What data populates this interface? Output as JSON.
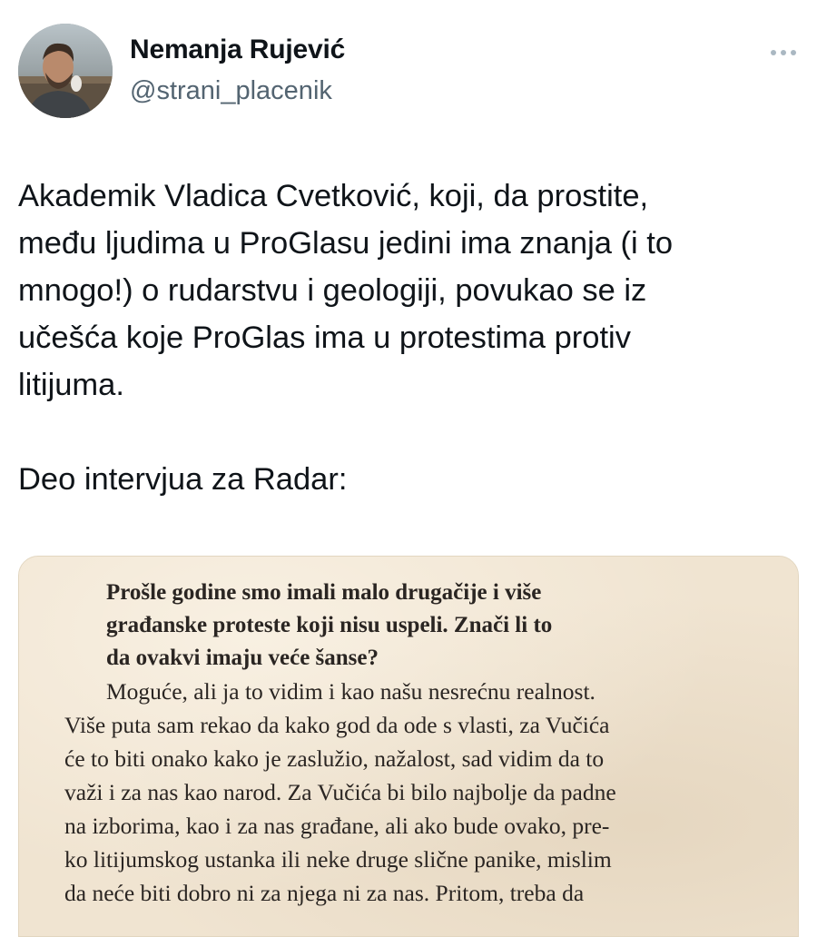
{
  "author": {
    "name": "Nemanja Rujević",
    "handle": "@strani_placenik"
  },
  "tweet": {
    "lines": [
      "Akademik Vladica Cvetković, koji, da prostite,",
      "među ljudima u ProGlasu jedini ima znanja (i to",
      "mnogo!) o rudarstvu i geologiji, povukao se iz",
      "učešća koje ProGlas ima u protestima protiv",
      "litijuma."
    ],
    "footer": "Deo intervjua za Radar:"
  },
  "media": {
    "question_lines": [
      "Prošle godine smo imali malo drugačije i više",
      "građanske proteste koji nisu uspeli. Znači li to",
      "da ovakvi imaju veće šanse?"
    ],
    "answer_lines": [
      "Moguće, ali ja to vidim i kao našu nesrećnu realnost.",
      "Više puta sam rekao da kako god da ode s vlasti, za Vučića",
      "će to biti onako kako je zaslužio, nažalost, sad vidim da to",
      "važi i za nas kao narod. Za Vučića bi bilo najbolje da padne",
      "na izborima, kao i za nas građane, ali ako bude ovako, pre-",
      "ko litijumskog ustanka ili neke druge slične panike, mislim",
      "da neće biti dobro ni za njega ni za nas. Pritom, treba da"
    ]
  }
}
